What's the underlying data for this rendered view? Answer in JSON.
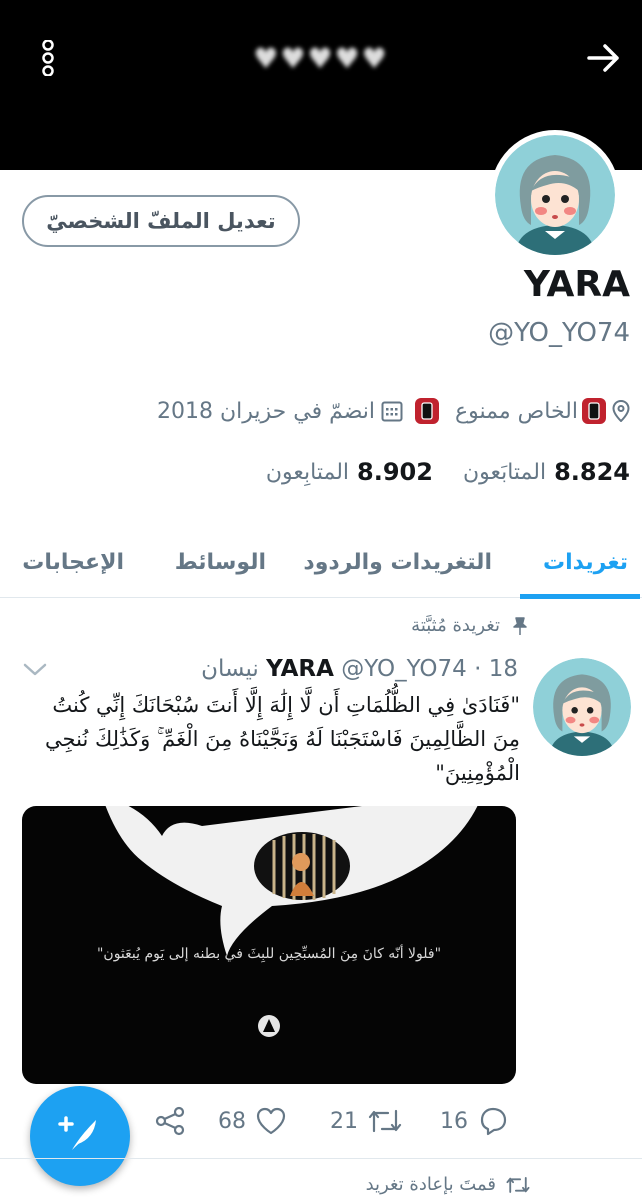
{
  "header": {
    "name_blurred": "♥♥♥♥♥",
    "menu_icon": "more-vertical-icon",
    "back_icon": "arrow-right-icon"
  },
  "profile": {
    "edit_button": "تعديل الملفّ الشخصيّ",
    "name": "YARA",
    "handle": "@YO_YO74",
    "location_icon": "location-pin-icon",
    "location_text": "الخاص ممنوع",
    "calendar_icon": "calendar-icon",
    "joined": "انضمّ في حزيران 2018",
    "badge_icon": "phone-badge-icon",
    "badge_color": "#c0222e",
    "following_count": "8.824",
    "following_label": "المتابَعون",
    "followers_count": "8.902",
    "followers_label": "المتابِعون"
  },
  "tabs": [
    {
      "label": "تغريدات",
      "active": true
    },
    {
      "label": "التغريدات والردود",
      "active": false
    },
    {
      "label": "الوسائط",
      "active": false
    },
    {
      "label": "الإعجابات",
      "active": false
    }
  ],
  "pinned_label": "تغريدة مُثبَّتة",
  "tweet": {
    "author": "YARA",
    "handle": "@YO_YO74",
    "separator": "·",
    "date": "18 نيسان",
    "text": "\"فَنَادَىٰ فِي الظُّلُمَاتِ أَن لَّا إِلَٰهَ إِلَّا أَنتَ سُبْحَانَكَ إِنِّي كُنتُ مِنَ الظَّالِمِينَ فَاسْتَجَبْنَا لَهُ وَنَجَّيْنَاهُ مِنَ الْغَمِّ ۚ وَكَذَٰلِكَ نُنجِي الْمُؤْمِنِينَ\"",
    "media_quote": "\"فلولا أنّه كانَ مِنَ المُسبِّحِين للبِثَ في بطنه إلى يَوم يُبعَثون\"",
    "replies": "16",
    "retweets": "21",
    "likes": "68"
  },
  "retweeted_label": "قمتَ بإعادة تغريد",
  "colors": {
    "accent": "#1da1f2",
    "secondary_text": "#657786",
    "header_bg": "#000000"
  }
}
